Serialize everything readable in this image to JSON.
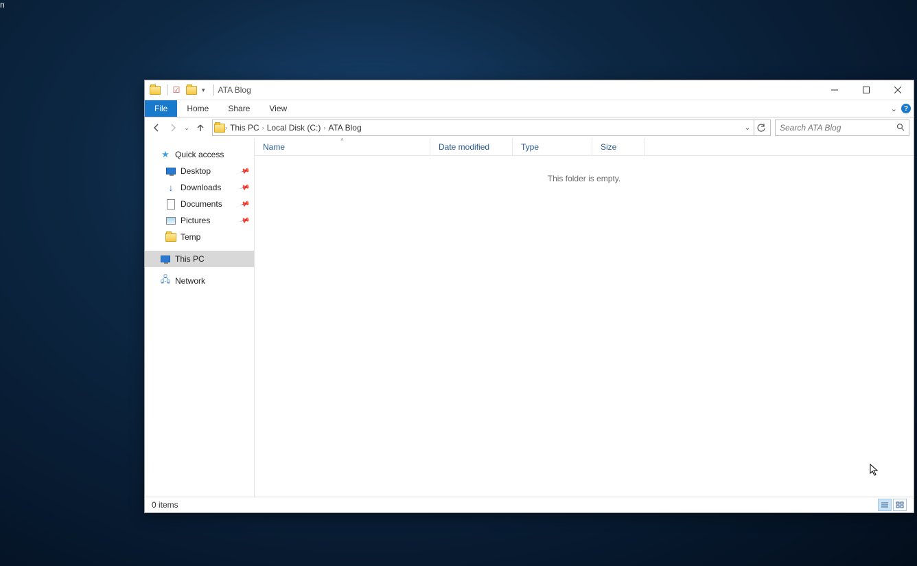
{
  "desktop_fragment": "n",
  "titlebar": {
    "window_title": "ATA Blog"
  },
  "ribbon": {
    "file": "File",
    "home": "Home",
    "share": "Share",
    "view": "View"
  },
  "breadcrumb": {
    "items": [
      "This PC",
      "Local Disk (C:)",
      "ATA Blog"
    ]
  },
  "search": {
    "placeholder": "Search ATA Blog"
  },
  "nav_pane": {
    "quick_access": "Quick access",
    "desktop": "Desktop",
    "downloads": "Downloads",
    "documents": "Documents",
    "pictures": "Pictures",
    "temp": "Temp",
    "this_pc": "This PC",
    "network": "Network"
  },
  "columns": {
    "name": "Name",
    "date": "Date modified",
    "type": "Type",
    "size": "Size"
  },
  "content": {
    "empty": "This folder is empty."
  },
  "status": {
    "items": "0 items"
  }
}
